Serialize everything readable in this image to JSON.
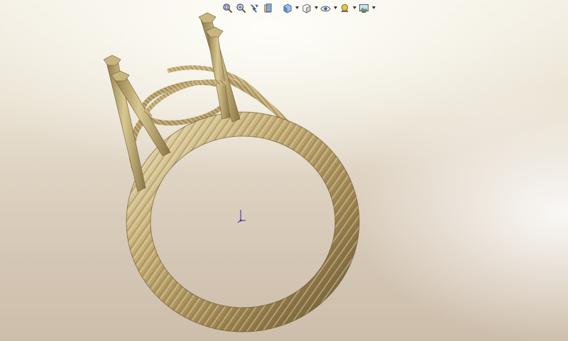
{
  "toolbar": {
    "buttons": [
      {
        "icon": "zoom-to-fit-icon"
      },
      {
        "icon": "zoom-to-area-icon"
      },
      {
        "icon": "previous-view-icon"
      },
      {
        "icon": "section-view-icon"
      },
      {
        "icon": "view-orientation-icon",
        "dropdown": true
      },
      {
        "icon": "display-style-icon",
        "dropdown": true
      },
      {
        "icon": "hide-show-items-icon",
        "dropdown": true
      },
      {
        "icon": "edit-appearance-icon",
        "dropdown": true
      },
      {
        "icon": "apply-scene-icon",
        "dropdown": true
      }
    ]
  },
  "model": {
    "name": "rope-twist-ring-solitaire",
    "color": "#b8a06a",
    "highlight": "#e4d4a4",
    "shadow": "#6e5c34"
  },
  "triad": {
    "color": "#2a2aa8"
  },
  "background": {
    "top": "#f3eee3",
    "bottom": "#cdbeab"
  }
}
